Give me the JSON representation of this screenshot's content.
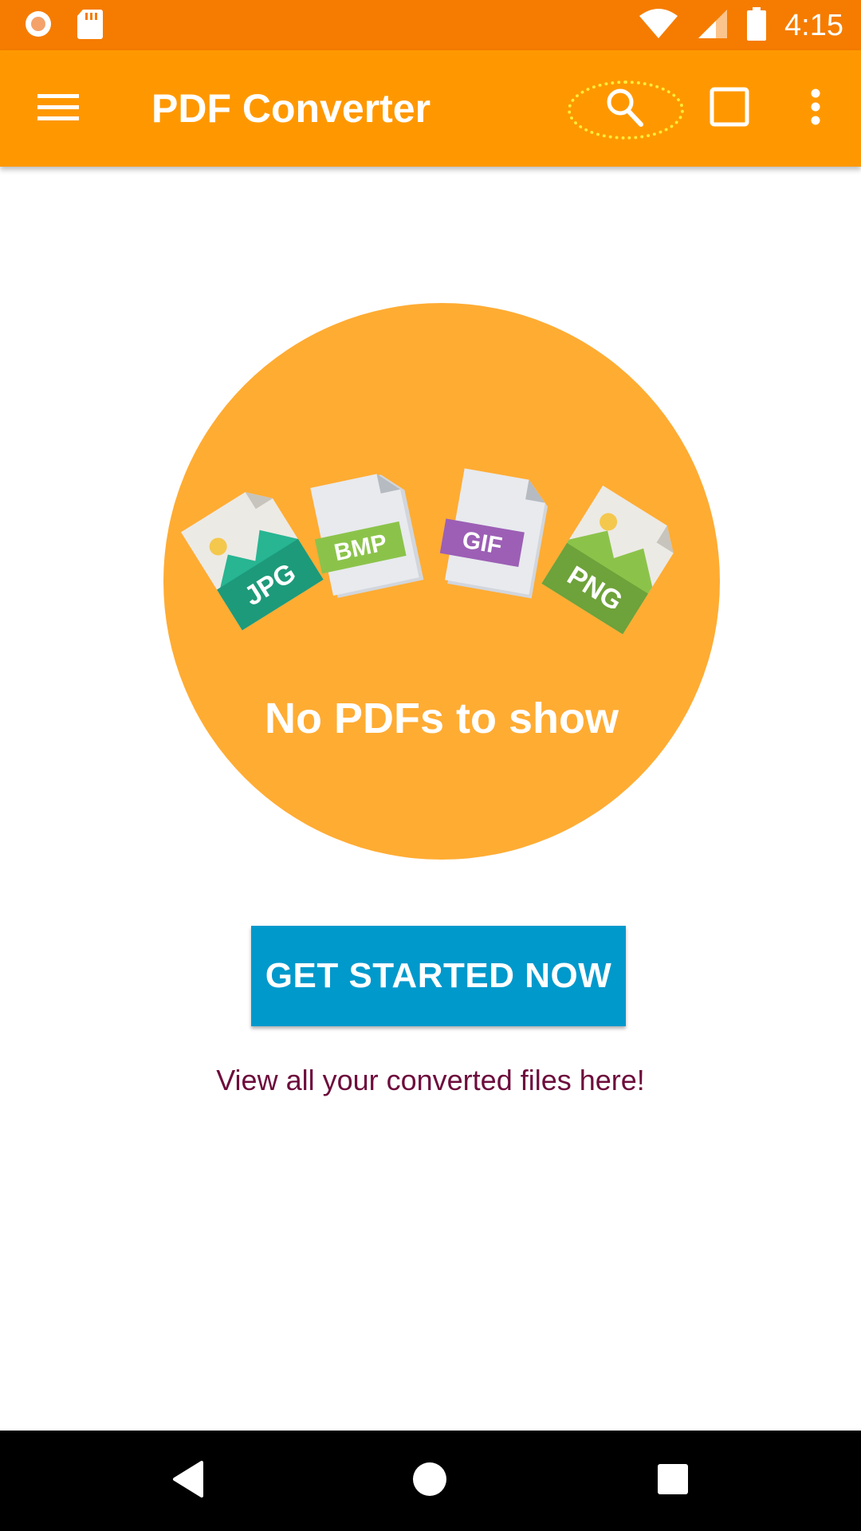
{
  "status_bar": {
    "time": "4:15",
    "icons": [
      "record-icon",
      "sd-card-icon",
      "wifi-icon",
      "signal-icon",
      "battery-icon"
    ]
  },
  "app_bar": {
    "title": "PDF Converter",
    "icons": [
      "menu-icon",
      "search-icon",
      "square-icon",
      "more-vert-icon"
    ]
  },
  "empty_state": {
    "title": "No PDFs to show",
    "file_types": [
      "JPG",
      "BMP",
      "GIF",
      "PNG"
    ],
    "circle_color": "#ffac33"
  },
  "cta": {
    "label": "GET STARTED NOW",
    "color": "#0099cc"
  },
  "helper_text": "View all your converted files here!",
  "nav_bar": {
    "icons": [
      "back-icon",
      "home-icon",
      "recents-icon"
    ]
  },
  "colors": {
    "status_bar": "#f57c00",
    "app_bar": "#ff9800",
    "search_highlight": "#ffeb3b"
  }
}
